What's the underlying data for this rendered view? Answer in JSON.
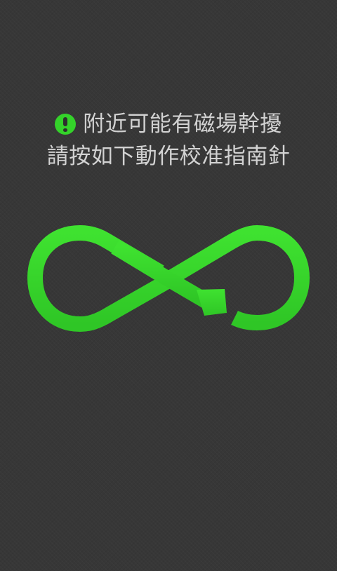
{
  "warning": {
    "icon": "exclamation-circle-icon",
    "line1": "附近可能有磁場幹擾",
    "line2": "請按如下動作校准指南針"
  },
  "graphic": {
    "icon": "figure-eight-calibration-arrow",
    "color": "#34d22a"
  },
  "colors": {
    "background": "#373737",
    "text": "#d2d2d2",
    "accent": "#34d22a"
  }
}
